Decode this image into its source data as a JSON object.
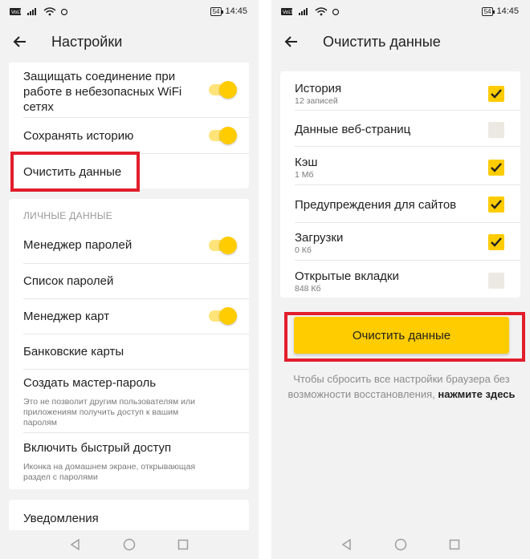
{
  "left": {
    "status": {
      "time": "14:45",
      "battery": "54"
    },
    "title": "Настройки",
    "rows": [
      {
        "label_lines": [
          "Защищать соединение при",
          "работе в небезопасных WiFi",
          "сетях"
        ],
        "toggle": true
      },
      {
        "label": "Сохранять историю",
        "toggle": true
      },
      {
        "label": "Очистить данные"
      }
    ],
    "personal_header": "ЛИЧНЫЕ ДАННЫЕ",
    "personal_rows": [
      {
        "label": "Менеджер паролей",
        "toggle": true
      },
      {
        "label": "Список паролей"
      },
      {
        "label": "Менеджер карт",
        "toggle": true
      },
      {
        "label": "Банковские карты"
      },
      {
        "label": "Создать мастер-пароль",
        "sub_lines": [
          "Это не позволит другим пользователям или",
          "приложениям получить доступ к вашим",
          "паролям"
        ]
      },
      {
        "label": "Включить быстрый доступ",
        "sub_lines": [
          "Иконка на домашнем экране, открывающая",
          "раздел с паролями"
        ]
      }
    ],
    "notifications": "Уведомления"
  },
  "right": {
    "status": {
      "time": "14:45",
      "battery": "54"
    },
    "title": "Очистить данные",
    "items": [
      {
        "label": "История",
        "sub": "12 записей",
        "checked": true
      },
      {
        "label": "Данные веб-страниц",
        "sub": "",
        "checked": false
      },
      {
        "label": "Кэш",
        "sub": "1 Мб",
        "checked": true
      },
      {
        "label": "Предупреждения для сайтов",
        "sub": "",
        "checked": true
      },
      {
        "label": "Загрузки",
        "sub": "0 Кб",
        "checked": true
      },
      {
        "label": "Открытые вкладки",
        "sub": "848 Кб",
        "checked": false
      }
    ],
    "clear_button": "Очистить данные",
    "reset_note": "Чтобы сбросить все настройки браузера без возможности восстановления,",
    "reset_link": "нажмите здесь"
  },
  "colors": {
    "accent": "#ffcc00",
    "highlight": "#e21d2b",
    "background": "#f2f2f2"
  }
}
